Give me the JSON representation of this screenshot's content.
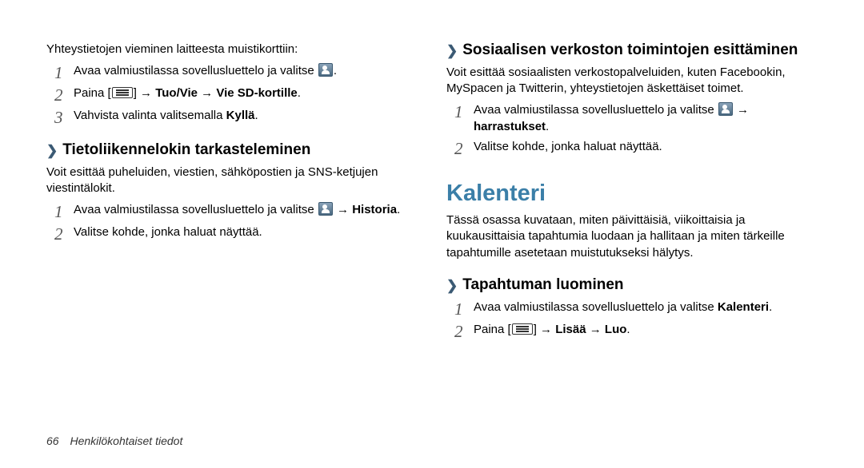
{
  "col1": {
    "intro": "Yhteystietojen vieminen laitteesta muistikorttiin:",
    "s1": "Avaa valmiustilassa sovellusluettelo ja valitse ",
    "s1_end": ".",
    "s2_a": "Paina [",
    "s2_b": "] → ",
    "s2_bold": "Tuo/Vie → Vie SD-kortille",
    "s2_end": ".",
    "s3_a": "Vahvista valinta valitsemalla ",
    "s3_bold": "Kyllä",
    "s3_end": ".",
    "secA_title": "Tietoliikennelokin tarkasteleminen",
    "secA_body": "Voit esittää puheluiden, viestien, sähköpostien ja SNS-ketjujen viestintälokit.",
    "secA_s1_a": "Avaa valmiustilassa sovellusluettelo ja valitse ",
    "secA_s1_arrow": " → ",
    "secA_s1_bold": "Historia",
    "secA_s1_end": ".",
    "secA_s2": "Valitse kohde, jonka haluat näyttää."
  },
  "col2": {
    "secB_title": "Sosiaalisen verkoston toimintojen esittäminen",
    "secB_body": "Voit esittää sosiaalisten verkostopalveluiden, kuten Facebookin, MySpacen ja Twitterin, yhteystietojen äskettäiset toimet.",
    "secB_s1_a": "Avaa valmiustilassa sovellusluettelo ja valitse ",
    "secB_s1_arrow": " → ",
    "secB_s1_bold": "harrastukset",
    "secB_s1_end": ".",
    "secB_s2": "Valitse kohde, jonka haluat näyttää.",
    "h1": "Kalenteri",
    "h1_body": "Tässä osassa kuvataan, miten päivittäisiä, viikoittaisia ja kuukausittaisia tapahtumia luodaan ja hallitaan ja miten tärkeille tapahtumille asetetaan muistutukseksi hälytys.",
    "secC_title": "Tapahtuman luominen",
    "secC_s1_a": "Avaa valmiustilassa sovellusluettelo ja valitse ",
    "secC_s1_bold": "Kalenteri",
    "secC_s1_end": ".",
    "secC_s2_a": "Paina [",
    "secC_s2_b": "] → ",
    "secC_s2_bold": "Lisää → Luo",
    "secC_s2_end": "."
  },
  "footer": {
    "page": "66",
    "title": "Henkilökohtaiset tiedot"
  },
  "glyphs": {
    "chevron": "❯"
  }
}
